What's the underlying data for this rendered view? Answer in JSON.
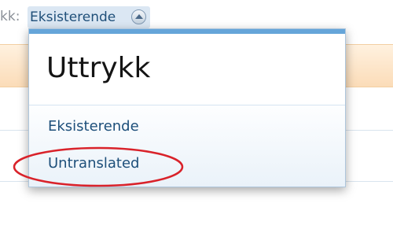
{
  "header": {
    "label_fragment": "kk:",
    "selected_value": "Eksisterende"
  },
  "dropdown": {
    "title": "Uttrykk",
    "options": [
      {
        "label": "Eksisterende"
      },
      {
        "label": "Untranslated"
      }
    ],
    "highlighted_option": "Untranslated"
  },
  "colors": {
    "accent": "#65a5d9",
    "link": "#1d4f7a",
    "highlight_ring": "#d9222a",
    "band": "#fbdcb8"
  },
  "icons": {
    "selector_arrow": "chevron-up-icon"
  }
}
